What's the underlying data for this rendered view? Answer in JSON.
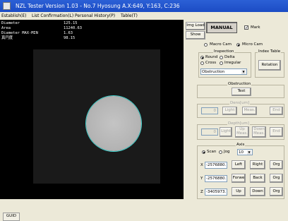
{
  "window": {
    "title": "NZL Tester Version 1.03 - No.7 Hyosung A.X:649, Y:163, C:236"
  },
  "menu": [
    "Establish(E)",
    "List Confirmation(L)",
    "Personal History(P)",
    "Table(T)"
  ],
  "readout": {
    "diameter_label": "Diameter",
    "diameter_value": "125.15",
    "area_label": "Area",
    "area_value": "11240.63",
    "maxmin_label": "Diameter MAX-MIN",
    "maxmin_value": "1.63",
    "roundness_label": "真円度",
    "roundness_value": "98.15"
  },
  "toolbar": {
    "img_load": "Img Load",
    "show": "Show",
    "manual": "MANUAL",
    "mark_label": "Mark",
    "mark_checked": true,
    "macro_cam": "Macro Cam",
    "micro_cam": "Micro Cam",
    "selected_cam": "micro"
  },
  "inspection": {
    "title": "Inspection",
    "options": [
      "Round",
      "Delta",
      "Cross",
      "Irregular"
    ],
    "selected": "Round",
    "dropdown_value": "Obstruction"
  },
  "index_table": {
    "title": "Index Table",
    "rotation": "Rotation"
  },
  "obstruction": {
    "title": "Obstruction",
    "test": "Test"
  },
  "dens": {
    "title": "Dens[um]",
    "value": "0",
    "light": "Light",
    "meas": "Meas.",
    "end": "End"
  },
  "depth": {
    "title": "Depth[um]",
    "value": "0",
    "light": "Light",
    "up_meas": "Up Meas.",
    "down_meas": "Down Meas.",
    "end": "End"
  },
  "axis": {
    "title": "Axis",
    "modes": [
      "Scan",
      "Jog"
    ],
    "selected_mode": "Scan",
    "step": "10",
    "rows": [
      {
        "label": "X",
        "value": "-2576880.",
        "b1": "Left",
        "b2": "Right",
        "b3": "Org"
      },
      {
        "label": "Y",
        "value": "-2576880.",
        "b1": "Forwe",
        "b2": "Back",
        "b3": "Org"
      },
      {
        "label": "Z",
        "value": "-3405973.",
        "b1": "Up",
        "b2": "Down",
        "b3": "Org"
      }
    ]
  },
  "taskbar": {
    "tab": "GUID"
  }
}
